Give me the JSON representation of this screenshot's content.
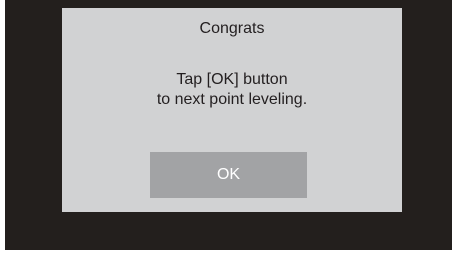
{
  "dialog": {
    "title": "Congrats",
    "message_line1": "Tap [OK] button",
    "message_line2": "to next point leveling.",
    "ok_label": "OK"
  },
  "colors": {
    "screen_background": "#231f1d",
    "dialog_background": "#d1d2d3",
    "button_background": "#a2a3a5",
    "button_text": "#ffffff",
    "text": "#231f20"
  }
}
